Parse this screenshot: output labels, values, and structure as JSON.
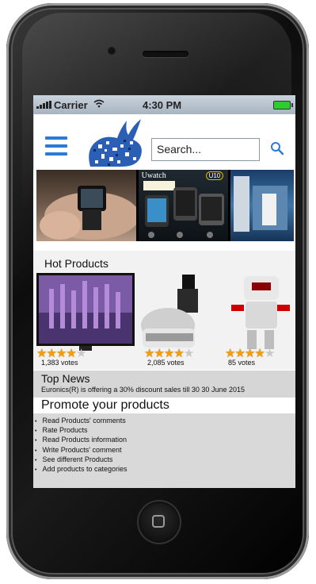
{
  "status_bar": {
    "carrier": "Carrier",
    "time": "4:30 PM"
  },
  "header": {
    "search_placeholder": "Search..."
  },
  "banner": {
    "uwatch_title": "Uwatch",
    "uwatch_badge": "U10"
  },
  "hot_products": {
    "title": "Hot Products",
    "items": [
      {
        "name": "TV",
        "rating": 4.5,
        "votes": "1,383 votes"
      },
      {
        "name": "Juicer",
        "rating": 4.5,
        "votes": "2,085 votes"
      },
      {
        "name": "Robot",
        "rating": 4.5,
        "votes": "85 votes"
      }
    ]
  },
  "top_news": {
    "title": "Top News",
    "text": "Euronics(R) is offering a 30% discount sales till 30 30 June 2015"
  },
  "promote": {
    "title": "Promote your products",
    "items": [
      "Read Products' comments",
      "Rate Products",
      "Read Products information",
      "Write Products' comment",
      "See different Products",
      "Add products to categories"
    ]
  },
  "colors": {
    "accent": "#2a7ad8",
    "star": "#f39c12"
  }
}
